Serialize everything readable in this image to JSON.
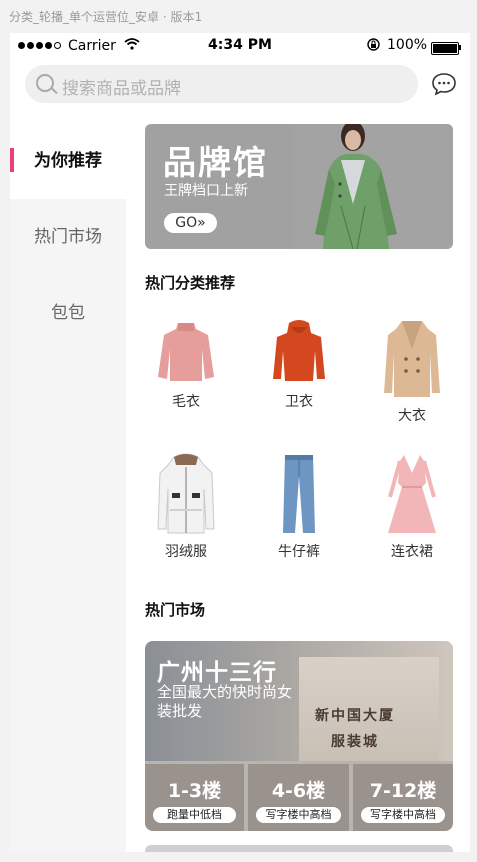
{
  "doc_title": "分类_轮播_单个运营位_安卓 · 版本1",
  "status": {
    "carrier": "Carrier",
    "time": "4:34 PM",
    "battery": "100%"
  },
  "search": {
    "placeholder": "搜索商品或品牌"
  },
  "sidebar": {
    "items": [
      {
        "label": "为你推荐"
      },
      {
        "label": "热门市场"
      },
      {
        "label": "包包"
      }
    ]
  },
  "banner": {
    "title": "品牌馆",
    "subtitle": "王牌档口上新",
    "go": "GO»"
  },
  "sections": {
    "categories_title": "热门分类推荐",
    "markets_title": "热门市场"
  },
  "categories": [
    {
      "label": "毛衣",
      "icon": "sweater-icon"
    },
    {
      "label": "卫衣",
      "icon": "hoodie-icon"
    },
    {
      "label": "大衣",
      "icon": "coat-icon"
    },
    {
      "label": "羽绒服",
      "icon": "down-jacket-icon"
    },
    {
      "label": "牛仔裤",
      "icon": "jeans-icon"
    },
    {
      "label": "连衣裙",
      "icon": "dress-icon"
    }
  ],
  "market": {
    "title": "广州十三行",
    "subtitle": "全国最大的快时尚女装批发",
    "sign_line1": "新中国大厦",
    "sign_line2": "服装城",
    "floors": [
      {
        "name": "1-3楼",
        "tag": "跑量中低档"
      },
      {
        "name": "4-6楼",
        "tag": "写字楼中高档"
      },
      {
        "name": "7-12楼",
        "tag": "写字楼中高档"
      }
    ]
  }
}
